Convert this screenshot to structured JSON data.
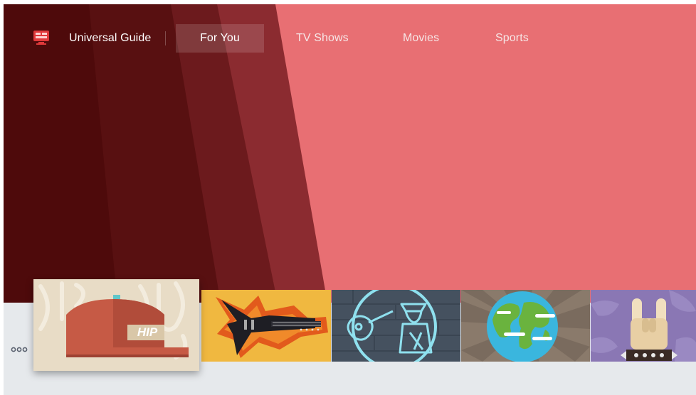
{
  "app": {
    "title": "Universal Guide",
    "icon": "universal-guide-icon"
  },
  "nav": {
    "tabs": [
      {
        "label": "For You",
        "selected": true
      },
      {
        "label": "TV Shows",
        "selected": false
      },
      {
        "label": "Movies",
        "selected": false
      },
      {
        "label": "Sports",
        "selected": false
      }
    ]
  },
  "tiles": [
    {
      "icon": "hip-hop-cap-icon",
      "caption": "HIP",
      "focused": true
    },
    {
      "icon": "rock-guitar-icon",
      "caption": "",
      "focused": false
    },
    {
      "icon": "folk-guitarist-icon",
      "caption": "",
      "focused": false
    },
    {
      "icon": "world-globe-icon",
      "caption": "",
      "focused": false
    },
    {
      "icon": "rock-hand-sign-icon",
      "caption": "",
      "focused": false
    }
  ],
  "more": {
    "icon": "more-dots-icon"
  },
  "colors": {
    "background_dark": "#4e0a0b",
    "background_mid": "#7a2226",
    "background_light": "#e86f73",
    "strip": "#e6e9ec",
    "accent": "#e0393b"
  }
}
